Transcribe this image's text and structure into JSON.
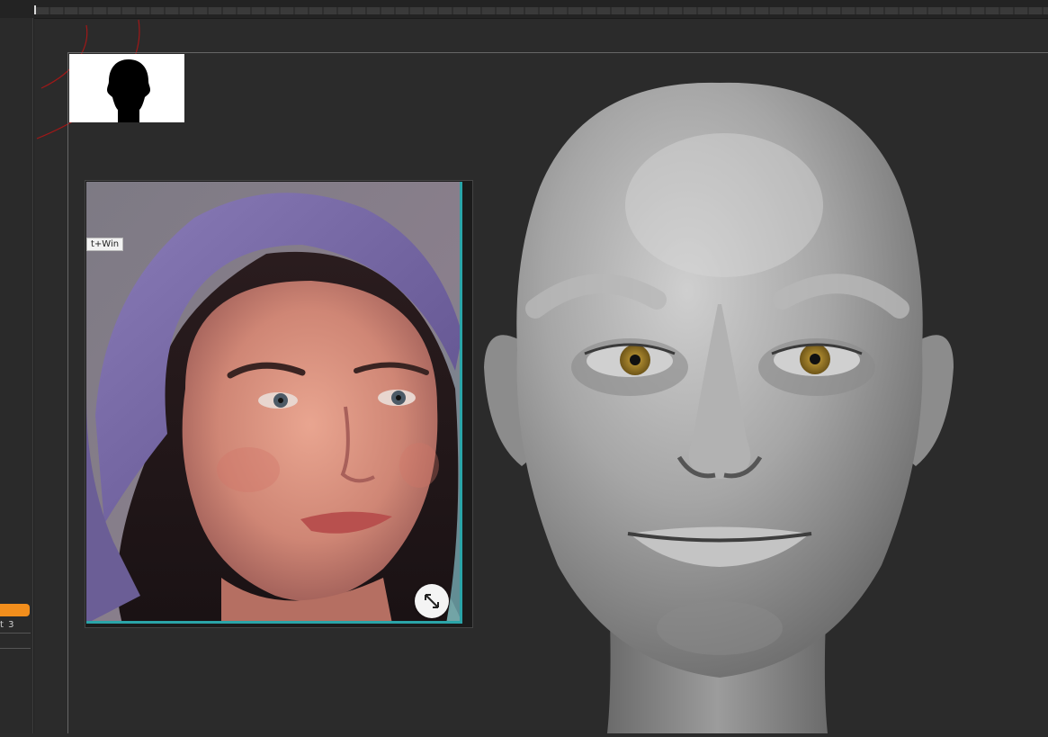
{
  "left_tray": {
    "subtool_label": "t 3"
  },
  "reference_panel": {
    "tooltip": "t+Win"
  },
  "icons": {
    "expand": "expand-arrows-icon",
    "silhouette": "head-silhouette-icon"
  },
  "colors": {
    "accent_orange": "#f28e1c",
    "frame_teal": "#2aa4a8",
    "background": "#2b2b2b"
  }
}
